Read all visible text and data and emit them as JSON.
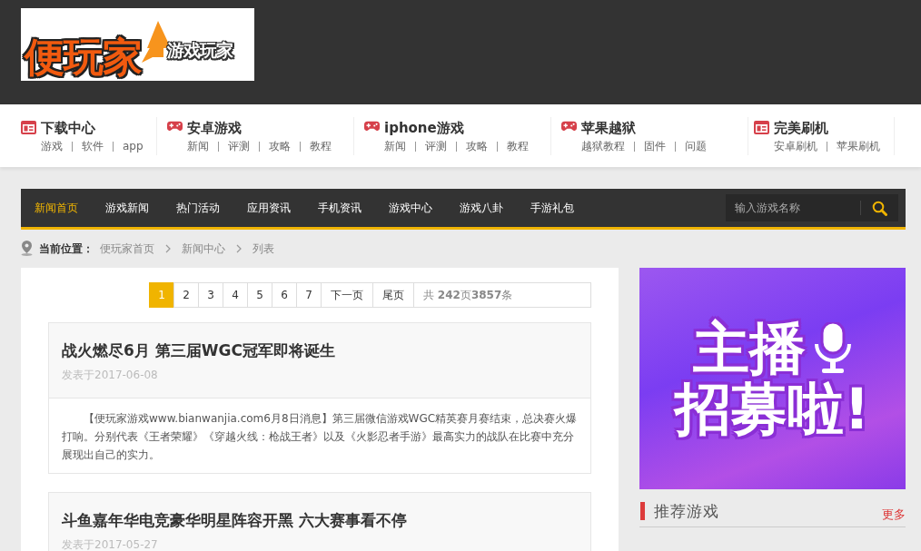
{
  "logo": {
    "name": "便玩家",
    "tagline": "游戏玩家"
  },
  "quick_nav": [
    {
      "kind": "page",
      "title": "下载中心",
      "links": [
        "游戏",
        "软件",
        "app"
      ]
    },
    {
      "kind": "game",
      "title": "安卓游戏",
      "links": [
        "新闻",
        "评测",
        "攻略",
        "教程"
      ]
    },
    {
      "kind": "game",
      "title": "iphone游戏",
      "links": [
        "新闻",
        "评测",
        "攻略",
        "教程"
      ]
    },
    {
      "kind": "game",
      "title": "苹果越狱",
      "links": [
        "越狱教程",
        "固件",
        "问题"
      ]
    },
    {
      "kind": "page",
      "title": "完美刷机",
      "links": [
        "安卓刷机",
        "苹果刷机"
      ]
    }
  ],
  "main_nav": {
    "items": [
      {
        "label": "新闻首页",
        "selected": true
      },
      {
        "label": "游戏新闻",
        "selected": false
      },
      {
        "label": "热门活动",
        "selected": false
      },
      {
        "label": "应用资讯",
        "selected": false
      },
      {
        "label": "手机资讯",
        "selected": false
      },
      {
        "label": "游戏中心",
        "selected": false
      },
      {
        "label": "游戏八卦",
        "selected": false
      },
      {
        "label": "手游礼包",
        "selected": false
      }
    ],
    "search": {
      "placeholder": "输入游戏名称"
    }
  },
  "breadcrumb": {
    "label": "当前位置：",
    "items": [
      "便玩家首页",
      "新闻中心",
      "列表"
    ]
  },
  "pagination": {
    "pages": [
      {
        "label": "1",
        "selected": true
      },
      {
        "label": "2",
        "selected": false
      },
      {
        "label": "3",
        "selected": false
      },
      {
        "label": "4",
        "selected": false
      },
      {
        "label": "5",
        "selected": false
      },
      {
        "label": "6",
        "selected": false
      },
      {
        "label": "7",
        "selected": false
      }
    ],
    "next": "下一页",
    "last": "尾页",
    "summary": "共 **242**页**3857**条"
  },
  "articles": [
    {
      "title": "战火燃尽6月 第三届WGC冠军即将诞生",
      "date": "发表于2017-06-08",
      "summary": "【便玩家游戏www.bianwanjia.com6月8日消息】第三届微信游戏WGC精英赛月赛结束，总决赛火爆打响。分别代表《王者荣耀》《穿越火线：枪战王者》以及《火影忍者手游》最高实力的战队在比赛中充分展现出自己的实力。"
    },
    {
      "title": "斗鱼嘉年华电竞豪华明星阵容开黑 六大赛事看不停",
      "date": "发表于2017-05-27"
    }
  ],
  "sidebar": {
    "banner": {
      "headline": "主播",
      "subline": "招募啦!"
    },
    "section": {
      "title": "推荐游戏",
      "more": "更多"
    }
  }
}
